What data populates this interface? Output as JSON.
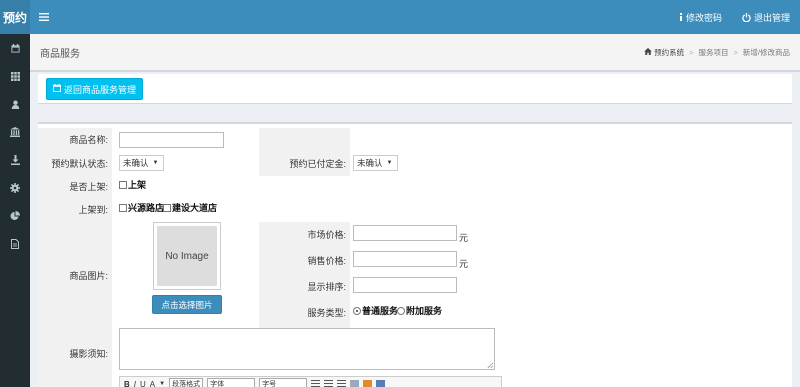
{
  "brand": "预约",
  "topbar": {
    "menu_icon": "hamburger-icon",
    "change_password": "修改密码",
    "logout": "退出管理"
  },
  "sidebar": {
    "icons": [
      "calendar-icon",
      "grid-icon",
      "user-icon",
      "bank-icon",
      "download-icon",
      "gear-icon",
      "pie-chart-icon",
      "file-icon"
    ]
  },
  "header": {
    "title": "商品服务",
    "breadcrumb": [
      "预约系统",
      "服务项目",
      "新增/修改商品"
    ]
  },
  "toolbar": {
    "back_label": "返回商品服务管理"
  },
  "form": {
    "name_label": "商品名称:",
    "name_value": "",
    "default_status_label": "预约默认状态:",
    "default_status_value": "未确认",
    "deposit_label": "预约已付定金:",
    "deposit_value": "未确认",
    "listed_label": "是否上架:",
    "listed_option": "上架",
    "listed_to_label": "上架到:",
    "stores": [
      "兴源路店",
      "建设大道店"
    ],
    "image_label": "商品图片:",
    "no_image": "No Image",
    "pick_image": "点击选择图片",
    "market_price_label": "市场价格:",
    "sale_price_label": "销售价格:",
    "sort_label": "显示排序:",
    "yuan": "元",
    "service_type_label": "服务类型:",
    "service_types": [
      "普通服务",
      "附加服务"
    ],
    "service_type_selected": "普通服务",
    "notice_label": "摄影须知:",
    "editor": {
      "bold": "B",
      "italic": "I",
      "underline": "U",
      "font_color": "A",
      "paragraph": "段落格式",
      "font_family": "字体",
      "font_size": "字号"
    }
  },
  "colors": {
    "topbar": "#3c8dbc",
    "brand_bg": "#367fa9",
    "sidebar": "#222d32",
    "back_button": "#00c0ef",
    "primary_button": "#3c8dbc"
  }
}
